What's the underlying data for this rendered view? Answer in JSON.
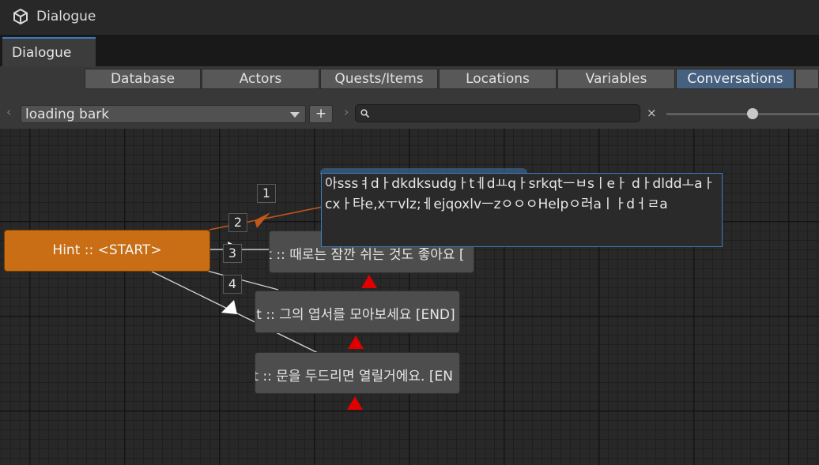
{
  "window": {
    "title": "Dialogue",
    "icon": "unity-logo-icon"
  },
  "tab": {
    "label": "Dialogue"
  },
  "nav_tabs": [
    {
      "label": "Database",
      "selected": false
    },
    {
      "label": "Actors",
      "selected": false
    },
    {
      "label": "Quests/Items",
      "selected": false
    },
    {
      "label": "Locations",
      "selected": false
    },
    {
      "label": "Variables",
      "selected": false
    },
    {
      "label": "Conversations",
      "selected": true
    }
  ],
  "toolbar": {
    "conversation_value": "loading bark",
    "add_label": "+",
    "search_value": "",
    "clear_label": "×",
    "icons": [
      "chevron-left-icon",
      "chevron-right-icon",
      "dropdown-arrow-icon",
      "search-icon"
    ]
  },
  "graph": {
    "start_node": "Hint :: <START>",
    "nodes": [
      "Hint :: 때로는 잠깐 쉬는 것도 좋아요 [",
      "Hint :: 그의 엽서를 모아보세요 [END]",
      "Hint :: 문을 두드리면 열릴거에요. [EN"
    ],
    "link_numbers": [
      "1",
      "2",
      "3",
      "4"
    ],
    "editor_text": "아sssㅕdㅏdkdksudgㅏtㅔdㅛqㅏsrkqtㅡㅂsㅣeㅏ dㅏdlddㅗaㅏcxㅏ탸e,xㅜvlz;ㅔejqoxlvㅡzㅇㅇㅇHelpㅇ러aㅣㅏdㅓㄹa"
  },
  "colors": {
    "start_node": "#c96e14",
    "node": "#4d4d4d",
    "selected_tab": "#46607f",
    "marker": "#e00000",
    "selected_link": "#c0581c",
    "focus_border": "#3b7fc4"
  }
}
